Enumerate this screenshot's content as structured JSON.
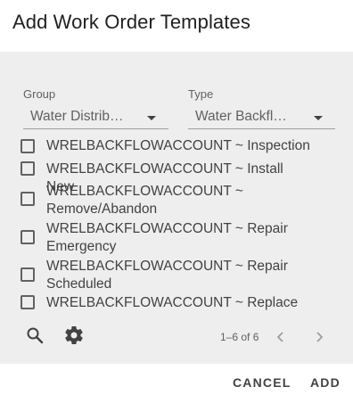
{
  "dialog": {
    "title": "Add Work Order Templates"
  },
  "filters": {
    "group": {
      "label": "Group",
      "value": "Water Distrib…"
    },
    "type": {
      "label": "Type",
      "value": "Water Backfl…"
    }
  },
  "items": [
    {
      "line1": "WRELBACKFLOWACCOUNT ~ Inspection",
      "line2": "",
      "checked": false
    },
    {
      "line1": "WRELBACKFLOWACCOUNT ~ Install New",
      "line2": "",
      "checked": false
    },
    {
      "line1": "WRELBACKFLOWACCOUNT ~",
      "line2": "Remove/Abandon",
      "checked": false
    },
    {
      "line1": "WRELBACKFLOWACCOUNT ~ Repair",
      "line2": "Emergency",
      "checked": false
    },
    {
      "line1": "WRELBACKFLOWACCOUNT ~ Repair",
      "line2": "Scheduled",
      "checked": false
    },
    {
      "line1": "WRELBACKFLOWACCOUNT ~ Replace",
      "line2": "",
      "checked": false
    }
  ],
  "toolbar": {
    "search_icon": "search-icon",
    "settings_icon": "gear-icon",
    "pagination": "1–6 of 6",
    "prev_icon": "chevron-left-icon",
    "next_icon": "chevron-right-icon"
  },
  "actions": {
    "cancel_label": "CANCEL",
    "add_label": "ADD"
  }
}
